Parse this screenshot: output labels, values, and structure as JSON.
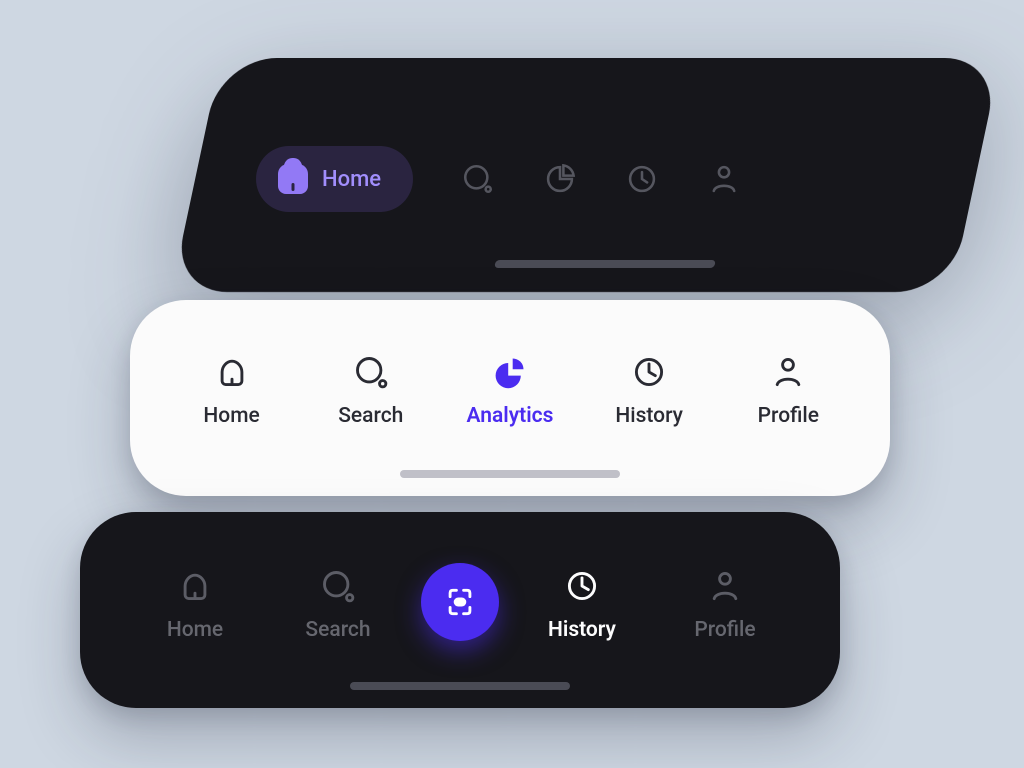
{
  "colors": {
    "accent": "#4b2cf0",
    "accentSoft": "#9279f5",
    "dark": "#16161b",
    "light": "#fbfbfb",
    "bg": "#ced7e2"
  },
  "bar1": {
    "active_label": "Home",
    "icons": [
      "home-icon",
      "search-icon",
      "analytics-icon",
      "history-icon",
      "profile-icon"
    ]
  },
  "bar2": {
    "items": [
      {
        "label": "Home",
        "icon": "home-icon",
        "active": false
      },
      {
        "label": "Search",
        "icon": "search-icon",
        "active": false
      },
      {
        "label": "Analytics",
        "icon": "analytics-icon",
        "active": true
      },
      {
        "label": "History",
        "icon": "history-icon",
        "active": false
      },
      {
        "label": "Profile",
        "icon": "profile-icon",
        "active": false
      }
    ]
  },
  "bar3": {
    "items": [
      {
        "label": "Home",
        "icon": "home-icon",
        "selected": false
      },
      {
        "label": "Search",
        "icon": "search-icon",
        "selected": false
      },
      {
        "label": "History",
        "icon": "history-icon",
        "selected": true
      },
      {
        "label": "Profile",
        "icon": "profile-icon",
        "selected": false
      }
    ],
    "center_action": "scan-icon"
  }
}
